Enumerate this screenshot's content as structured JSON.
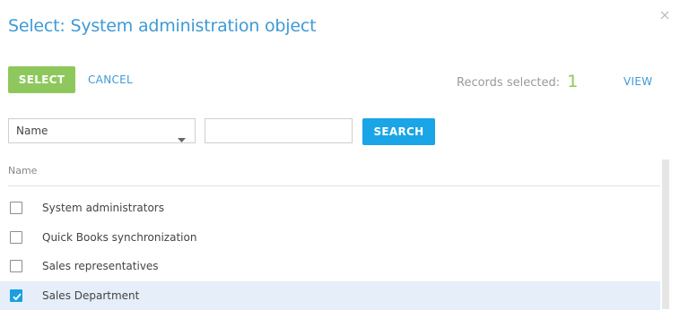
{
  "dialog": {
    "title": "Select: System administration object",
    "close_icon": "close-icon"
  },
  "toolbar": {
    "select_label": "SELECT",
    "cancel_label": "CANCEL",
    "records_selected_label": "Records selected:",
    "records_selected_count": "1",
    "view_label": "VIEW"
  },
  "filter": {
    "column_value": "Name",
    "search_value": "",
    "search_placeholder": "",
    "search_label": "SEARCH"
  },
  "grid": {
    "column_header": "Name",
    "rows": [
      {
        "label": "System administrators",
        "checked": false
      },
      {
        "label": "Quick Books synchronization",
        "checked": false
      },
      {
        "label": "Sales representatives",
        "checked": false
      },
      {
        "label": "Sales Department",
        "checked": true
      }
    ]
  },
  "colors": {
    "title": "#3f9ad6",
    "select_button": "#8ec85c",
    "search_button": "#1aa5e6",
    "selected_row": "#e5eef9",
    "checkbox_checked": "#1a9fe0"
  }
}
